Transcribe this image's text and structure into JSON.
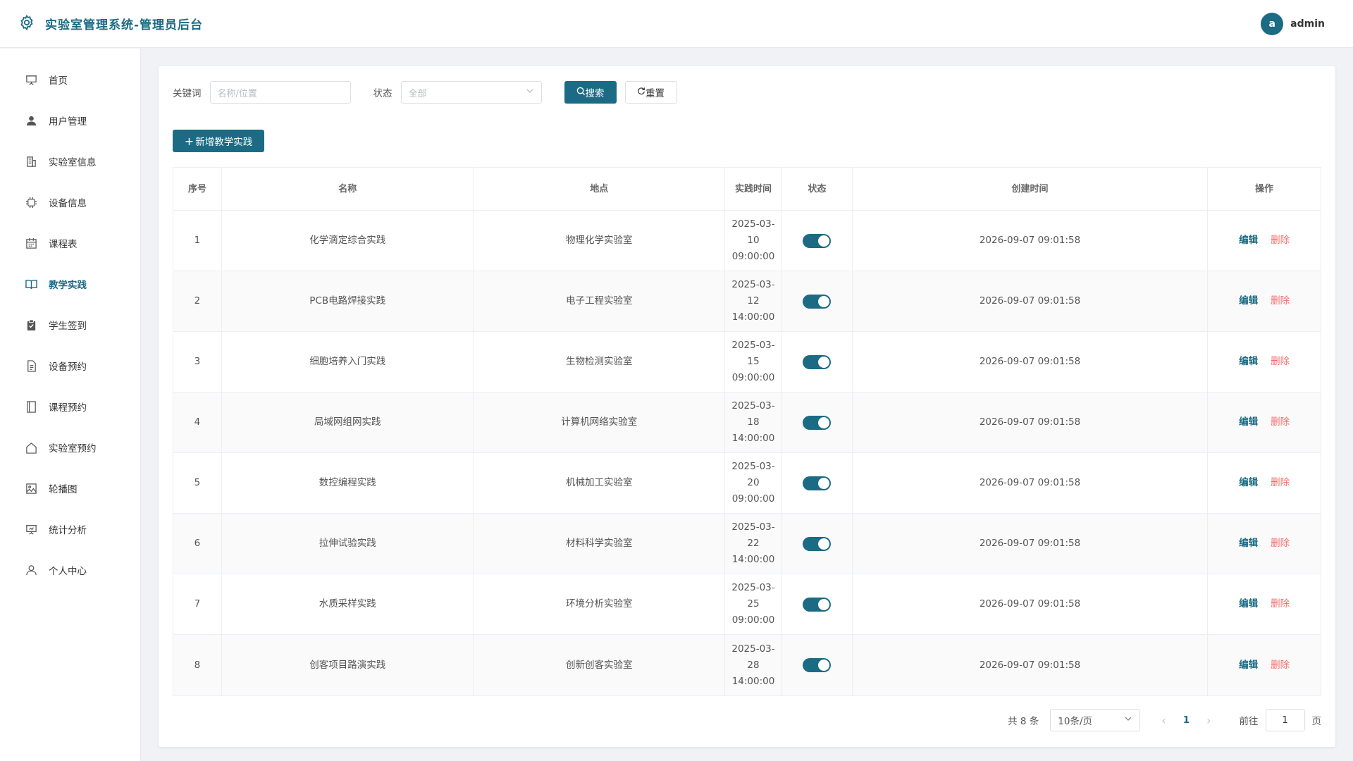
{
  "header": {
    "title": "实验室管理系统-管理员后台",
    "avatar_letter": "a",
    "username": "admin",
    "brand_color": "#1b6b84"
  },
  "sidebar": {
    "items": [
      {
        "label": "首页",
        "icon": "presentation-icon"
      },
      {
        "label": "用户管理",
        "icon": "user-icon"
      },
      {
        "label": "实验室信息",
        "icon": "building-icon"
      },
      {
        "label": "设备信息",
        "icon": "chip-icon"
      },
      {
        "label": "课程表",
        "icon": "calendar-icon"
      },
      {
        "label": "教学实践",
        "icon": "book-icon",
        "active": true
      },
      {
        "label": "学生签到",
        "icon": "clipboard-check-icon"
      },
      {
        "label": "设备预约",
        "icon": "document-icon"
      },
      {
        "label": "课程预约",
        "icon": "notebook-icon"
      },
      {
        "label": "实验室预约",
        "icon": "house-icon"
      },
      {
        "label": "轮播图",
        "icon": "picture-icon"
      },
      {
        "label": "统计分析",
        "icon": "chart-board-icon"
      },
      {
        "label": "个人中心",
        "icon": "person-icon"
      }
    ]
  },
  "filter": {
    "keyword_label": "关键词",
    "keyword_placeholder": "名称/位置",
    "status_label": "状态",
    "status_value": "全部",
    "search_label": "搜索",
    "reset_label": "重置"
  },
  "add_button": "新增教学实践",
  "table": {
    "headers": [
      "序号",
      "名称",
      "地点",
      "实践时间",
      "状态",
      "创建时间",
      "操作"
    ],
    "edit_label": "编辑",
    "delete_label": "删除",
    "rows": [
      {
        "no": "1",
        "name": "化学滴定综合实践",
        "place": "物理化学实验室",
        "time": "2025-03-10 09:00:00",
        "status_on": true,
        "created": "2026-09-07 09:01:58"
      },
      {
        "no": "2",
        "name": "PCB电路焊接实践",
        "place": "电子工程实验室",
        "time": "2025-03-12 14:00:00",
        "status_on": true,
        "created": "2026-09-07 09:01:58"
      },
      {
        "no": "3",
        "name": "细胞培养入门实践",
        "place": "生物检测实验室",
        "time": "2025-03-15 09:00:00",
        "status_on": true,
        "created": "2026-09-07 09:01:58"
      },
      {
        "no": "4",
        "name": "局域网组网实践",
        "place": "计算机网络实验室",
        "time": "2025-03-18 14:00:00",
        "status_on": true,
        "created": "2026-09-07 09:01:58"
      },
      {
        "no": "5",
        "name": "数控编程实践",
        "place": "机械加工实验室",
        "time": "2025-03-20 09:00:00",
        "status_on": true,
        "created": "2026-09-07 09:01:58"
      },
      {
        "no": "6",
        "name": "拉伸试验实践",
        "place": "材料科学实验室",
        "time": "2025-03-22 14:00:00",
        "status_on": true,
        "created": "2026-09-07 09:01:58"
      },
      {
        "no": "7",
        "name": "水质采样实践",
        "place": "环境分析实验室",
        "time": "2025-03-25 09:00:00",
        "status_on": true,
        "created": "2026-09-07 09:01:58"
      },
      {
        "no": "8",
        "name": "创客项目路演实践",
        "place": "创新创客实验室",
        "time": "2025-03-28 14:00:00",
        "status_on": true,
        "created": "2026-09-07 09:01:58"
      }
    ]
  },
  "pagination": {
    "total": "共 8 条",
    "page_size": "10条/页",
    "current_page": "1",
    "goto_label": "前往",
    "goto_value": "1",
    "page_suffix": "页"
  }
}
